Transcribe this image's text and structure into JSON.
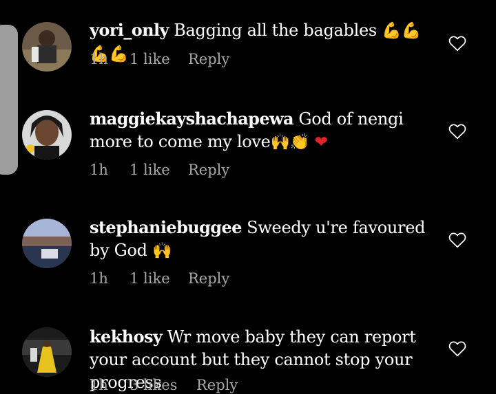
{
  "comments": [
    {
      "username": "yori_only",
      "text": "Bagging all the bagables",
      "emoji": "💪💪💪💪",
      "time": "1h",
      "likes": "1 like",
      "reply": "Reply"
    },
    {
      "username": "maggiekayshachapewa",
      "text": "God of nengi more to come my love",
      "emoji": "🙌👏",
      "emoji2": "❤",
      "time": "1h",
      "likes": "1 like",
      "reply": "Reply"
    },
    {
      "username": "stephaniebuggee",
      "text": "Sweedy u're favoured by God",
      "emoji": "🙌",
      "time": "1h",
      "likes": "1 like",
      "reply": "Reply"
    },
    {
      "username": "kekhosy",
      "text": "Wr move baby they can report your account but they cannot stop your progress",
      "time": "1h",
      "likes": "3 likes",
      "reply": "Reply"
    }
  ],
  "colors": {
    "background": "#000000",
    "text": "#ffffff",
    "meta": "#a8a8a8",
    "scroll_handle": "#9e9e9e"
  }
}
